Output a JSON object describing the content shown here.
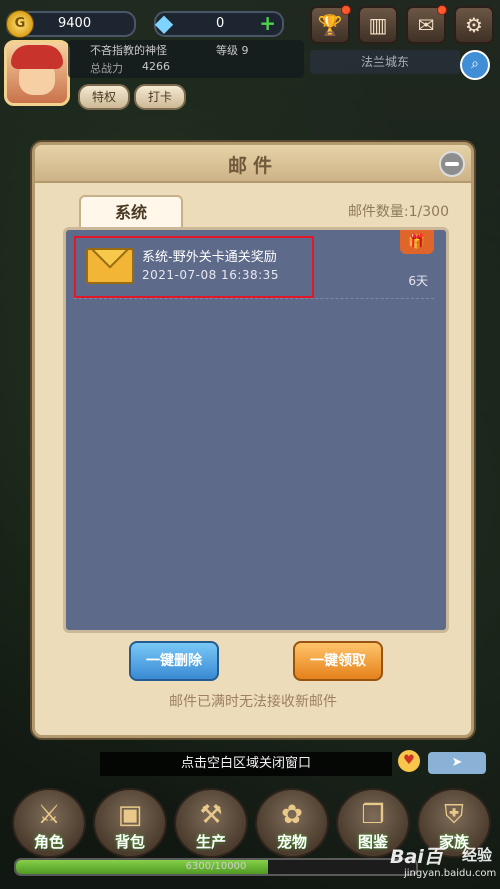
{
  "top_bar": {
    "gold": "9400",
    "gems": "0",
    "gem_add": "+",
    "gold_icon": "coin-icon",
    "gem_icon": "diamond-icon",
    "buttons": [
      {
        "icon": "trophy-icon",
        "glyph": "🏆",
        "dot": true
      },
      {
        "icon": "chart-icon",
        "glyph": "▥",
        "dot": false
      },
      {
        "icon": "mail-icon",
        "glyph": "✉",
        "dot": true
      },
      {
        "icon": "gear-icon",
        "glyph": "⚙",
        "dot": false
      }
    ]
  },
  "player": {
    "name": "不吝指教的神怪",
    "level_label": "等级 9",
    "power_label": "总战力",
    "power_value": "4266",
    "privilege_label": "特权",
    "checkin_label": "打卡"
  },
  "city": {
    "name": "法兰城东",
    "search_icon": "search-icon"
  },
  "mail_dialog": {
    "title": "邮件",
    "tab_label": "系统",
    "count_label": "邮件数量:1/300",
    "mails": [
      {
        "subject": "系统-野外关卡通关奖励",
        "date": "2021-07-08 16:38:35",
        "days_left": "6天",
        "has_gift": true
      }
    ],
    "delete_all_label": "一键删除",
    "claim_all_label": "一键领取",
    "full_note": "邮件已满时无法接收新邮件"
  },
  "bottom": {
    "close_hint": "点击空白区域关闭窗口",
    "nav": [
      {
        "label": "角色",
        "icon": "character-icon"
      },
      {
        "label": "背包",
        "icon": "backpack-icon"
      },
      {
        "label": "生产",
        "icon": "production-icon"
      },
      {
        "label": "宠物",
        "icon": "pet-icon"
      },
      {
        "label": "图鉴",
        "icon": "codex-icon"
      },
      {
        "label": "家族",
        "icon": "family-icon"
      }
    ],
    "xp_text": "6300/10000",
    "xp_fraction": 0.63
  },
  "watermark": {
    "logo": "Bai百",
    "cn": "经验",
    "url": "jingyan.baidu.com"
  },
  "colors": {
    "modal_bg": "#ecdcba",
    "list_bg": "#5e6a89",
    "highlight": "#e0182a",
    "delete_btn": "#3a8ad4",
    "claim_btn": "#e5811b"
  }
}
